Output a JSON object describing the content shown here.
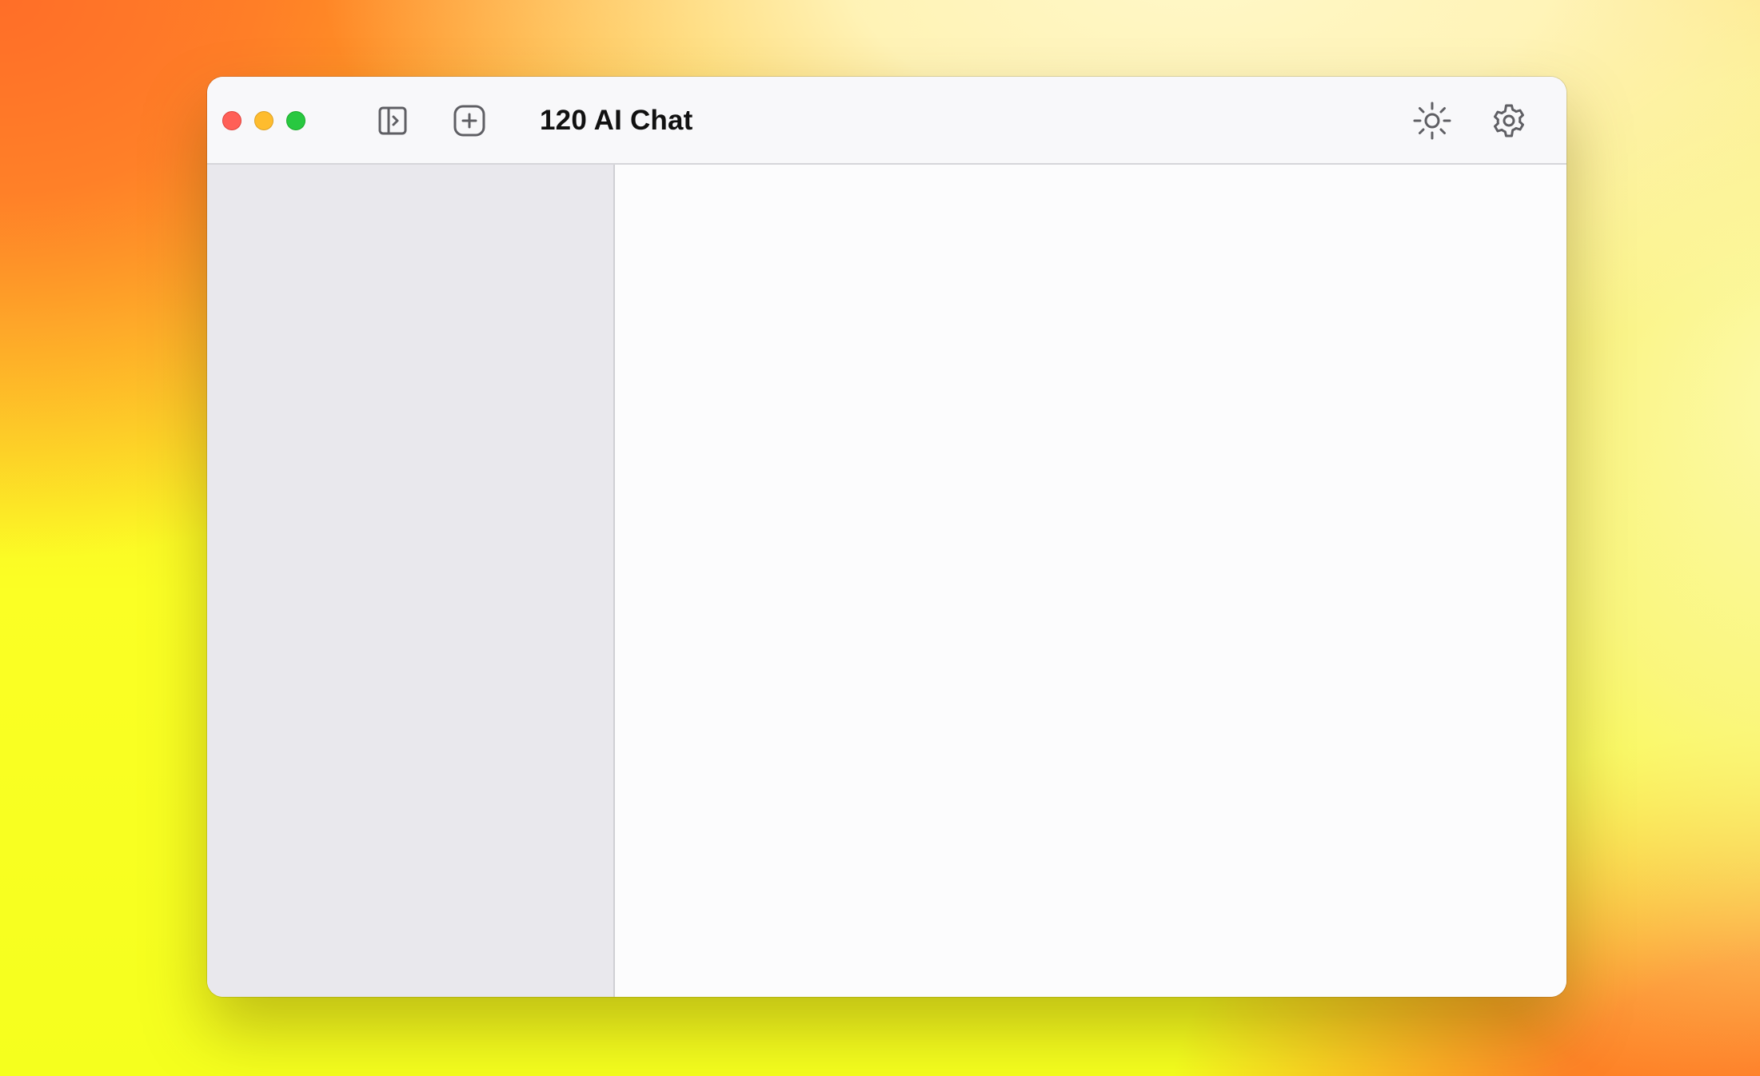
{
  "window": {
    "title": "120 AI Chat"
  },
  "toolbar": {
    "traffic_lights": {
      "close_color": "#ff5f57",
      "minimize_color": "#febc2e",
      "zoom_color": "#28c840"
    },
    "icons": {
      "sidebar_toggle": "sidebar-toggle-icon",
      "new_chat": "plus-square-icon",
      "theme": "sun-icon",
      "settings": "gear-icon"
    }
  },
  "colors": {
    "sidebar_bg": "#e9e8ed",
    "main_bg": "#fcfcfd",
    "titlebar_bg": "#f8f8fa",
    "icon_color": "#5f5f64"
  }
}
